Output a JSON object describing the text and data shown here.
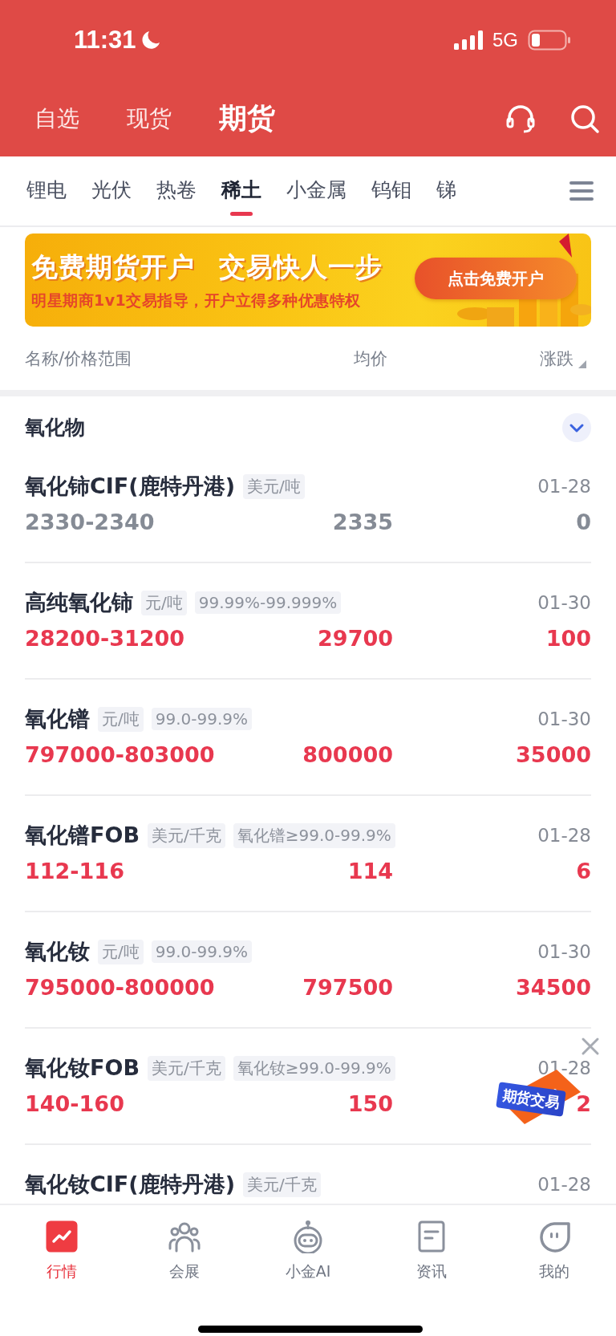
{
  "status_bar": {
    "time": "11:31",
    "network": "5G"
  },
  "top_tabs": [
    {
      "label": "自选",
      "selected": false
    },
    {
      "label": "现货",
      "selected": false
    },
    {
      "label": "期货",
      "selected": true
    }
  ],
  "category_tabs": [
    {
      "label": "锂电",
      "selected": false
    },
    {
      "label": "光伏",
      "selected": false
    },
    {
      "label": "热卷",
      "selected": false
    },
    {
      "label": "稀土",
      "selected": true
    },
    {
      "label": "小金属",
      "selected": false
    },
    {
      "label": "钨钼",
      "selected": false
    },
    {
      "label": "锑",
      "selected": false
    }
  ],
  "banner": {
    "headline": [
      "免费期货开户",
      "交易快人一步"
    ],
    "subline": "明星期商1v1交易指导，开户立得多种优惠特权",
    "button": "点击免费开户"
  },
  "columns": [
    "名称/价格范围",
    "均价",
    "涨跌"
  ],
  "section": {
    "title": "氧化物"
  },
  "rows": [
    {
      "name": "氧化铈CIF(鹿特丹港)",
      "tags": [
        "美元/吨"
      ],
      "date": "01-28",
      "range": "2330-2340",
      "average": "2335",
      "change": "0",
      "kind": "flat"
    },
    {
      "name": "高纯氧化铈",
      "tags": [
        "元/吨",
        "99.99%-99.999%"
      ],
      "date": "01-30",
      "range": "28200-31200",
      "average": "29700",
      "change": "100",
      "kind": "up"
    },
    {
      "name": "氧化镨",
      "tags": [
        "元/吨",
        "99.0-99.9%"
      ],
      "date": "01-30",
      "range": "797000-803000",
      "average": "800000",
      "change": "35000",
      "kind": "up"
    },
    {
      "name": "氧化镨FOB",
      "tags": [
        "美元/千克",
        "氧化镨≥99.0-99.9%"
      ],
      "date": "01-28",
      "range": "112-116",
      "average": "114",
      "change": "6",
      "kind": "up"
    },
    {
      "name": "氧化钕",
      "tags": [
        "元/吨",
        "99.0-99.9%"
      ],
      "date": "01-30",
      "range": "795000-800000",
      "average": "797500",
      "change": "34500",
      "kind": "up"
    },
    {
      "name": "氧化钕FOB",
      "tags": [
        "美元/千克",
        "氧化钕≥99.0-99.9%"
      ],
      "date": "01-28",
      "range": "140-160",
      "average": "150",
      "change": "2",
      "kind": "up"
    },
    {
      "name": "氧化钕CIF(鹿特丹港)",
      "tags": [
        "美元/千克"
      ],
      "date": "01-28"
    }
  ],
  "float_ad": {
    "label": "期货交易"
  },
  "bottom_nav": [
    {
      "label": "行情",
      "selected": true
    },
    {
      "label": "会展",
      "selected": false
    },
    {
      "label": "小金AI",
      "selected": false
    },
    {
      "label": "资讯",
      "selected": false
    },
    {
      "label": "我的",
      "selected": false
    }
  ]
}
